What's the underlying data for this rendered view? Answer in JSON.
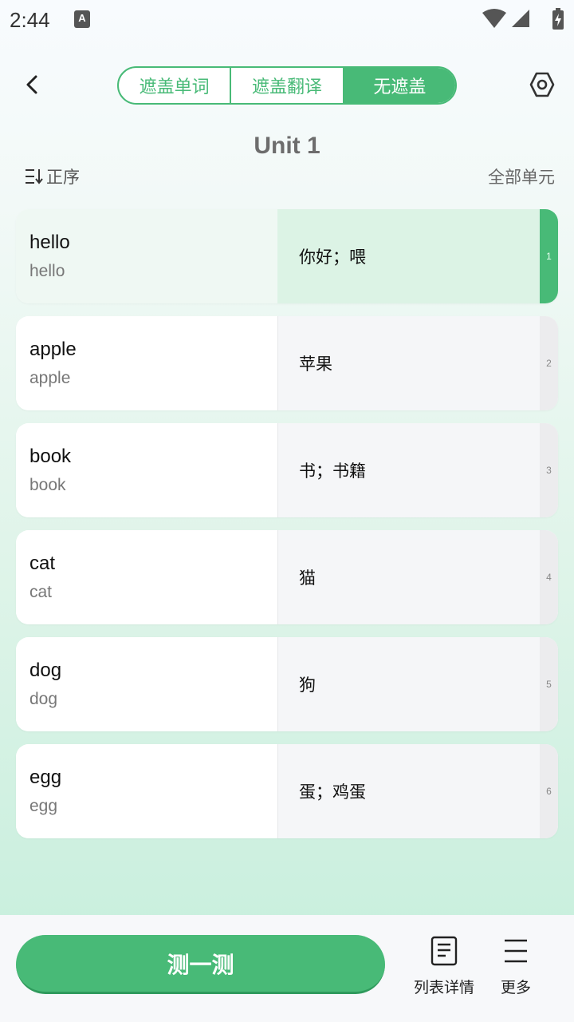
{
  "status_bar": {
    "time": "2:44",
    "app_icon_letter": "A"
  },
  "top_bar": {
    "segments": [
      {
        "label": "遮盖单词",
        "active": false
      },
      {
        "label": "遮盖翻译",
        "active": false
      },
      {
        "label": "无遮盖",
        "active": true
      }
    ]
  },
  "header": {
    "unit_title": "Unit 1",
    "sort_label": "正序",
    "all_units_label": "全部单元"
  },
  "words": [
    {
      "word": "hello",
      "sub": "hello",
      "translation": "你好；喂",
      "index": "1",
      "active": true
    },
    {
      "word": "apple",
      "sub": "apple",
      "translation": "苹果",
      "index": "2",
      "active": false
    },
    {
      "word": "book",
      "sub": "book",
      "translation": "书；书籍",
      "index": "3",
      "active": false
    },
    {
      "word": "cat",
      "sub": "cat",
      "translation": "猫",
      "index": "4",
      "active": false
    },
    {
      "word": "dog",
      "sub": "dog",
      "translation": "狗",
      "index": "5",
      "active": false
    },
    {
      "word": "egg",
      "sub": "egg",
      "translation": "蛋；鸡蛋",
      "index": "6",
      "active": false
    }
  ],
  "bottom_bar": {
    "test_label": "测一测",
    "detail_label": "列表详情",
    "more_label": "更多"
  },
  "colors": {
    "accent": "#48ba77",
    "active_card_right": "#dcf3e5"
  },
  "icons": {
    "back": "back-arrow-icon",
    "settings": "settings-hexagon-icon",
    "sort": "sort-icon",
    "detail": "document-list-icon",
    "more": "menu-lines-icon"
  }
}
